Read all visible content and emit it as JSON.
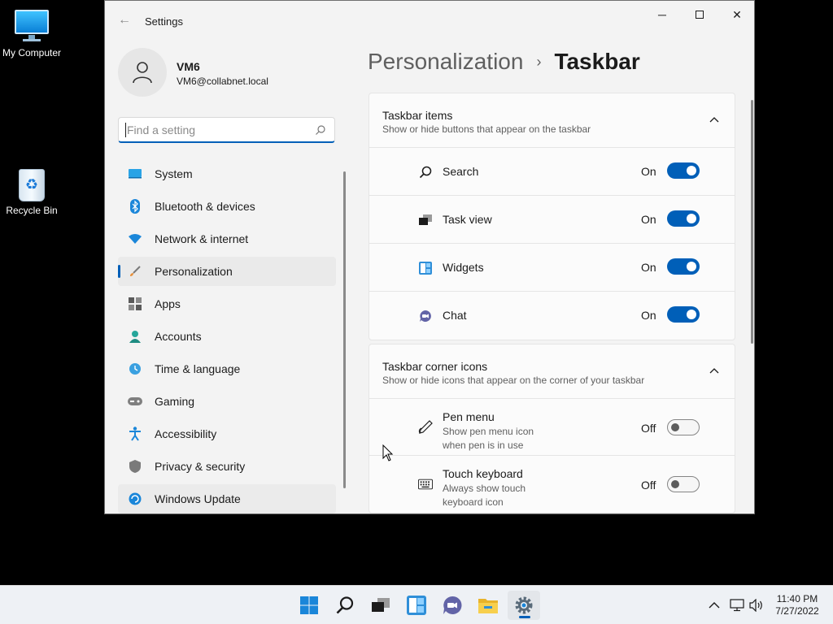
{
  "desktop": {
    "icons": [
      {
        "label": "My Computer",
        "icon": "monitor-icon"
      },
      {
        "label": "Recycle Bin",
        "icon": "recycle-bin-icon"
      }
    ]
  },
  "window": {
    "title": "Settings",
    "controls": {
      "minimize": "─",
      "close": "✕"
    }
  },
  "profile": {
    "name": "VM6",
    "email": "VM6@collabnet.local"
  },
  "search": {
    "placeholder": "Find a setting",
    "value": ""
  },
  "nav": {
    "items": [
      {
        "label": "System",
        "icon": "monitor-icon",
        "state": "normal"
      },
      {
        "label": "Bluetooth & devices",
        "icon": "bluetooth-icon",
        "state": "normal"
      },
      {
        "label": "Network & internet",
        "icon": "wifi-icon",
        "state": "normal"
      },
      {
        "label": "Personalization",
        "icon": "brush-icon",
        "state": "active"
      },
      {
        "label": "Apps",
        "icon": "apps-icon",
        "state": "normal"
      },
      {
        "label": "Accounts",
        "icon": "person-icon",
        "state": "normal"
      },
      {
        "label": "Time & language",
        "icon": "clock-globe-icon",
        "state": "normal"
      },
      {
        "label": "Gaming",
        "icon": "gamepad-icon",
        "state": "normal"
      },
      {
        "label": "Accessibility",
        "icon": "accessibility-icon",
        "state": "normal"
      },
      {
        "label": "Privacy & security",
        "icon": "shield-icon",
        "state": "normal"
      },
      {
        "label": "Windows Update",
        "icon": "update-icon",
        "state": "hover"
      }
    ]
  },
  "breadcrumb": {
    "parent": "Personalization",
    "separator": "›",
    "current": "Taskbar"
  },
  "taskbar_items": {
    "title": "Taskbar items",
    "subtitle": "Show or hide buttons that appear on the taskbar",
    "rows": [
      {
        "label": "Search",
        "state": "On",
        "on": true,
        "icon": "search-icon"
      },
      {
        "label": "Task view",
        "state": "On",
        "on": true,
        "icon": "task-view-icon"
      },
      {
        "label": "Widgets",
        "state": "On",
        "on": true,
        "icon": "widgets-icon"
      },
      {
        "label": "Chat",
        "state": "On",
        "on": true,
        "icon": "chat-icon"
      }
    ]
  },
  "corner_icons": {
    "title": "Taskbar corner icons",
    "subtitle": "Show or hide icons that appear on the corner of your taskbar",
    "rows": [
      {
        "label": "Pen menu",
        "description": "Show pen menu icon when pen is in use",
        "state": "Off",
        "on": false,
        "icon": "pen-icon"
      },
      {
        "label": "Touch keyboard",
        "description": "Always show touch keyboard icon",
        "state": "Off",
        "on": false,
        "icon": "keyboard-icon"
      }
    ]
  },
  "system_taskbar": {
    "apps": [
      "start-icon",
      "search-icon",
      "task-view-icon",
      "widgets-icon",
      "chat-icon",
      "file-explorer-icon",
      "settings-icon"
    ],
    "tray": [
      "chevron-up-icon",
      "network-icon",
      "volume-icon"
    ],
    "time": "11:40 PM",
    "date": "7/27/2022"
  },
  "colors": {
    "accent": "#005fb8",
    "window_bg": "#f3f3f3",
    "card_bg": "#fbfbfb",
    "desktop_bg": "#000000"
  }
}
